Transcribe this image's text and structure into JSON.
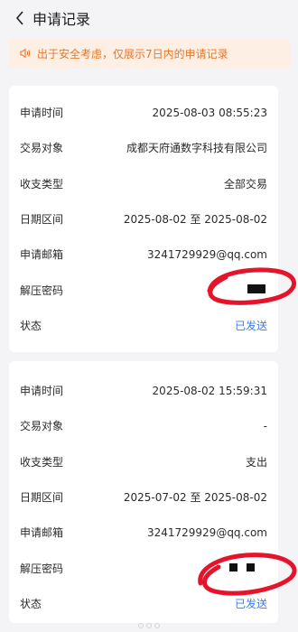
{
  "header": {
    "title": "申请记录"
  },
  "icons": {
    "back": "chevron-left-icon",
    "notice": "speaker-icon"
  },
  "notice": {
    "text": "出于安全考虑，仅展示7日内的申请记录",
    "color": "#e5772a",
    "background": "#fdefe4"
  },
  "colors": {
    "status": "#3b7cf0",
    "annotation": "#e6142b"
  },
  "records": [
    {
      "apply_time_label": "申请时间",
      "apply_time": "2025-08-03 08:55:23",
      "counterparty_label": "交易对象",
      "counterparty": "成都天府通数字科技有限公司",
      "type_label": "收支类型",
      "type": "全部交易",
      "range_label": "日期区间",
      "range": "2025-08-02 至 2025-08-02",
      "email_label": "申请邮箱",
      "email": "3241729929@qq.com",
      "password_label": "解压密码",
      "password": "[redacted]",
      "status_label": "状态",
      "status": "已发送"
    },
    {
      "apply_time_label": "申请时间",
      "apply_time": "2025-08-02 15:59:31",
      "counterparty_label": "交易对象",
      "counterparty": "-",
      "type_label": "收支类型",
      "type": "支出",
      "range_label": "日期区间",
      "range": "2025-07-02 至 2025-08-02",
      "email_label": "申请邮箱",
      "email": "3241729929@qq.com",
      "password_label": "解压密码",
      "password": "[redacted]",
      "status_label": "状态",
      "status": "已发送"
    }
  ]
}
